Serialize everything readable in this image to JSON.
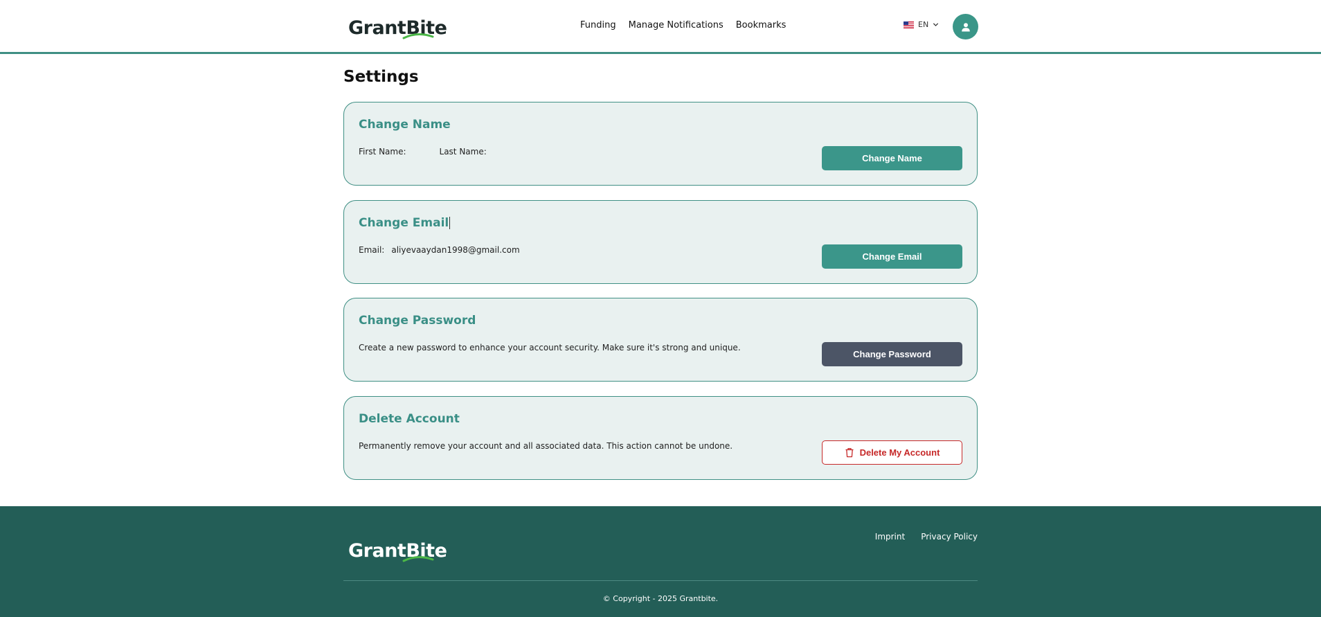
{
  "header": {
    "logo_text": "GrantBite",
    "nav": [
      {
        "label": "Funding"
      },
      {
        "label": "Manage Notifications"
      },
      {
        "label": "Bookmarks"
      }
    ],
    "language": "EN",
    "icons": [
      "us-flag-icon",
      "chevron-down-icon",
      "user-icon"
    ]
  },
  "page": {
    "title": "Settings"
  },
  "cards": {
    "name": {
      "title": "Change Name",
      "first_name_label": "First Name:",
      "last_name_label": "Last Name:",
      "button": "Change Name"
    },
    "email": {
      "title": "Change Email",
      "email_label": "Email:",
      "email_value": "aliyevaaydan1998@gmail.com",
      "button": "Change Email"
    },
    "password": {
      "title": "Change Password",
      "description": "Create a new password to enhance your account security. Make sure it's strong and unique.",
      "button": "Change Password"
    },
    "delete": {
      "title": "Delete Account",
      "description": "Permanently remove your account and all associated data. This action cannot be undone.",
      "button": "Delete My Account",
      "icon": "trash-icon"
    }
  },
  "footer": {
    "logo_text": "GrantBite",
    "links": [
      {
        "label": "Imprint"
      },
      {
        "label": "Privacy Policy"
      }
    ],
    "copyright": "© Copyright - 2025 Grantbite."
  },
  "colors": {
    "accent": "#3b968a",
    "card_bg": "#e9f1f0",
    "footer_bg": "#235e57",
    "danger": "#c62828",
    "dark_button": "#4c5566"
  }
}
